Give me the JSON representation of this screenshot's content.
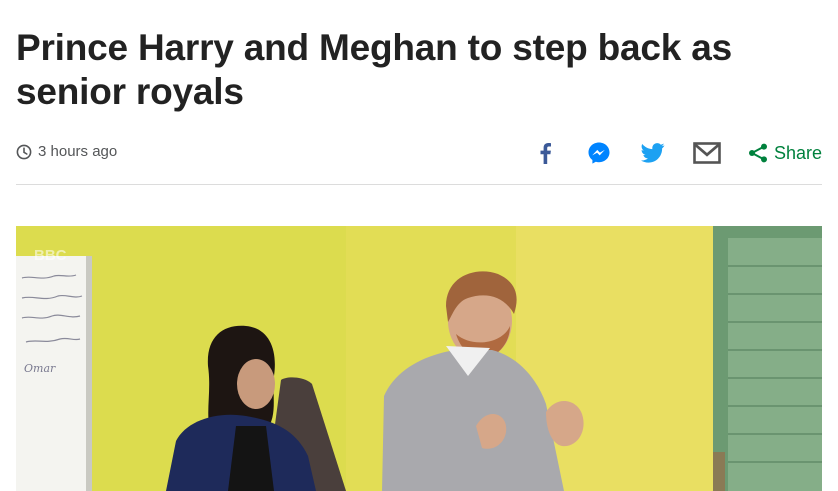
{
  "article": {
    "headline": "Prince Harry and Meghan to step back as senior royals",
    "timestamp": "3 hours ago"
  },
  "share": {
    "label": "Share",
    "icons": [
      "facebook-icon",
      "messenger-icon",
      "twitter-icon",
      "email-icon",
      "share-icon"
    ]
  },
  "media": {
    "watermark": "BBC",
    "whiteboard_text": [
      "...",
      "...",
      "...",
      "...",
      "Omar"
    ]
  },
  "colors": {
    "headline": "#222222",
    "meta": "#545658",
    "facebook": "#3b5998",
    "messenger": "#0084ff",
    "twitter": "#1da1f2",
    "email": "#555555",
    "share_accent": "#00813d"
  }
}
